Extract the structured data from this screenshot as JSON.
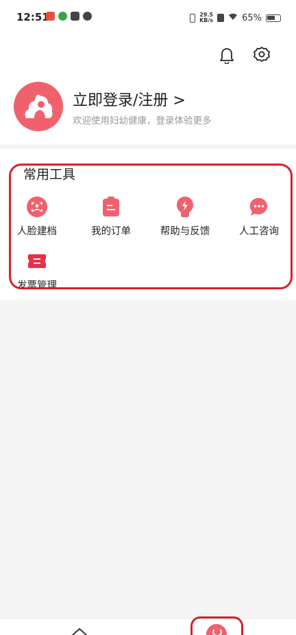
{
  "status_bar": {
    "time": "12:51",
    "net_speed_value": "29.5",
    "net_speed_unit": "KB/s",
    "battery": "65%"
  },
  "header": {
    "login_title": "立即登录/注册 >",
    "login_subtitle": "欢迎使用妇幼健康，登录体验更多"
  },
  "tools": {
    "title": "常用工具",
    "items": [
      {
        "label": "人脸建档",
        "icon": "face-scan-icon"
      },
      {
        "label": "我的订单",
        "icon": "order-icon"
      },
      {
        "label": "帮助与反馈",
        "icon": "lightning-icon"
      },
      {
        "label": "人工咨询",
        "icon": "chat-icon"
      },
      {
        "label": "发票管理",
        "icon": "invoice-icon"
      }
    ]
  },
  "colors": {
    "accent": "#f0616e",
    "annotation": "#d6202a",
    "background": "#f4f4f4"
  }
}
